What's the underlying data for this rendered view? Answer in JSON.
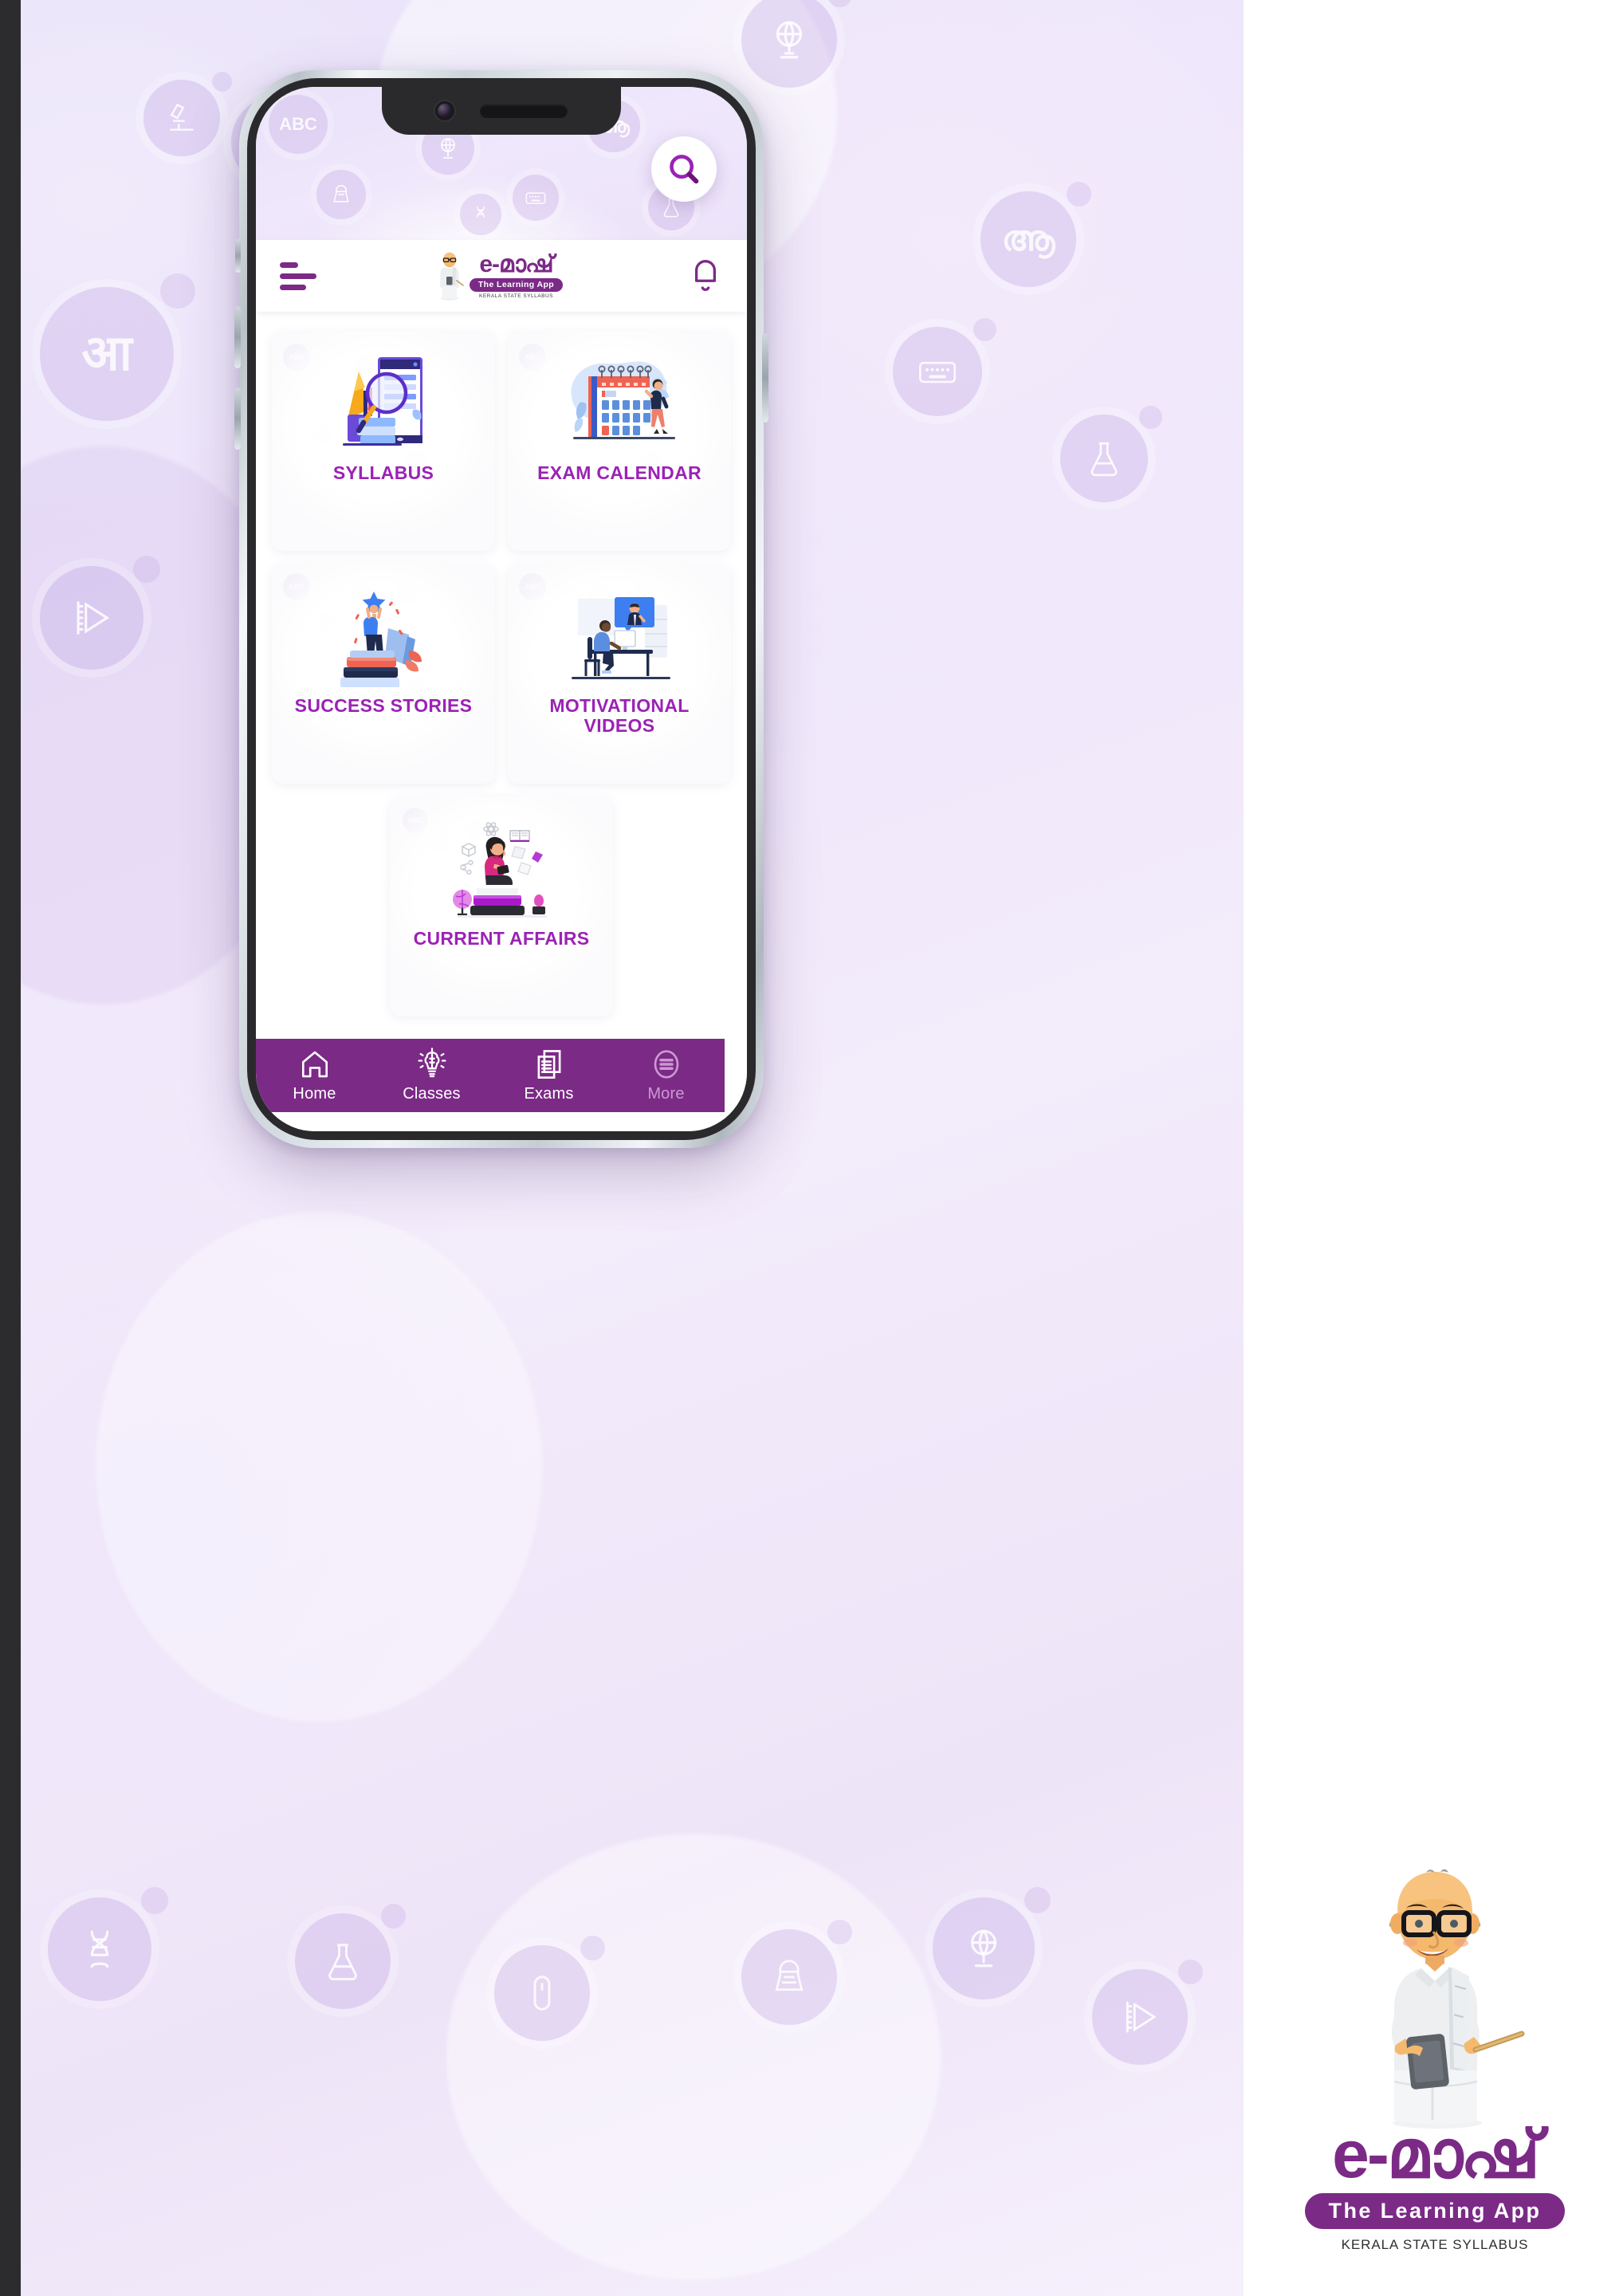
{
  "brand": {
    "word": "e-മാഷ്",
    "tagline": "The Learning App",
    "subtitle": "KERALA STATE SYLLABUS"
  },
  "header": {
    "menu_icon": "hamburger-menu-icon",
    "logo_word": "e-മാഷ്",
    "logo_tagline": "The Learning App",
    "logo_subtitle": "KERALA STATE SYLLABUS",
    "notification_icon": "bell-icon"
  },
  "search": {
    "icon": "search-icon",
    "label": "Search"
  },
  "colors": {
    "brand_purple": "#7b2a86",
    "label_magenta": "#9b22b5",
    "nav_bar": "#7b2a86",
    "backdrop_lavender": "#eee4f8",
    "card_bg": "#fbfafc"
  },
  "cards": [
    {
      "label": "SYLLABUS",
      "icon": "syllabus-illustration"
    },
    {
      "label": "EXAM CALENDAR",
      "icon": "calendar-illustration"
    },
    {
      "label": "SUCCESS STORIES",
      "icon": "trophy-books-illustration"
    },
    {
      "label": "MOTIVATIONAL\nVIDEOS",
      "label_line1": "MOTIVATIONAL",
      "label_line2": "VIDEOS",
      "icon": "video-lesson-illustration"
    },
    {
      "label": "CURRENT AFFAIRS",
      "icon": "reading-girl-illustration"
    }
  ],
  "bottom_nav": [
    {
      "label": "Home",
      "icon": "home-icon",
      "active": true
    },
    {
      "label": "Classes",
      "icon": "brain-bulb-icon",
      "active": false
    },
    {
      "label": "Exams",
      "icon": "documents-icon",
      "active": false
    },
    {
      "label": "More",
      "icon": "more-menu-icon",
      "active": false
    }
  ],
  "backdrop_badges": [
    {
      "glyph": "आ"
    },
    {
      "glyph": "ABC"
    },
    {
      "glyph": "ആ"
    },
    {
      "glyph": "globe-icon"
    },
    {
      "glyph": "sphinx-icon"
    },
    {
      "glyph": "dna-icon"
    },
    {
      "glyph": "keyboard-icon"
    },
    {
      "glyph": "flask-icon"
    },
    {
      "glyph": "ruler-play-icon"
    },
    {
      "glyph": "microscope-icon"
    },
    {
      "glyph": "mouse-icon"
    }
  ]
}
